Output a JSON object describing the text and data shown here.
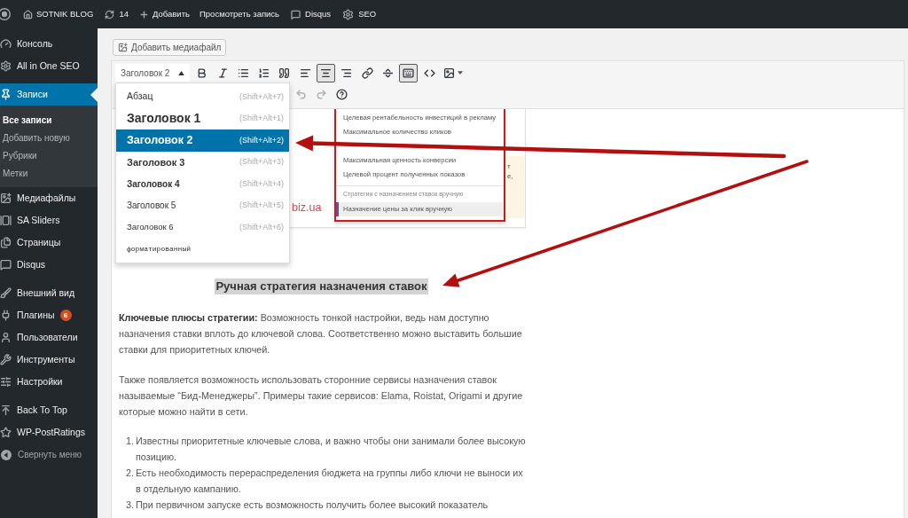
{
  "admin_bar": {
    "site_name": "SOTNIK BLOG",
    "updates_count": "14",
    "add_new": "Добавить",
    "view_post": "Просмотреть запись",
    "disqus": "Disqus",
    "seo": "SEO"
  },
  "sidebar": {
    "sections": [
      {
        "items": [
          {
            "kind": "dashboard",
            "label": "Консоль",
            "selected": false
          },
          {
            "kind": "gear",
            "label": "All in One SEO",
            "selected": false
          }
        ]
      },
      {
        "items": [
          {
            "kind": "pin",
            "label": "Записи",
            "selected": true,
            "children": [
              {
                "label": "Все записи",
                "selected": true
              },
              {
                "label": "Добавить новую",
                "selected": false
              },
              {
                "label": "Рубрики",
                "selected": false
              },
              {
                "label": "Метки",
                "selected": false
              }
            ]
          },
          {
            "kind": "media",
            "label": "Медиафайлы",
            "selected": false
          },
          {
            "kind": "slides",
            "label": "SA Sliders",
            "selected": false
          },
          {
            "kind": "pages",
            "label": "Страницы",
            "selected": false
          },
          {
            "kind": "comment",
            "label": "Disqus",
            "selected": false
          }
        ]
      },
      {
        "items": [
          {
            "kind": "brush",
            "label": "Внешний вид",
            "selected": false
          },
          {
            "kind": "plug",
            "label": "Плагины",
            "badge": "6",
            "selected": false
          },
          {
            "kind": "user",
            "label": "Пользователи",
            "selected": false
          },
          {
            "kind": "wrench",
            "label": "Инструменты",
            "selected": false
          },
          {
            "kind": "settings",
            "label": "Настройки",
            "selected": false
          }
        ]
      },
      {
        "items": [
          {
            "kind": "upload",
            "label": "Back To Top",
            "selected": false
          },
          {
            "kind": "star",
            "label": "WP-PostRatings",
            "selected": false
          }
        ]
      }
    ],
    "collapse": "Свернуть меню"
  },
  "editor": {
    "media_button": "Добавить медиафайл",
    "format_select": {
      "value": "Заголовок 2",
      "expanded": true,
      "options": [
        {
          "kind": "paragraph",
          "label": "Абзац",
          "shortcut": "(Shift+Alt+7)",
          "selected": false
        },
        {
          "kind": "h1",
          "label": "Заголовок 1",
          "shortcut": "(Shift+Alt+1)",
          "selected": false
        },
        {
          "kind": "h2",
          "label": "Заголовок 2",
          "shortcut": "(Shift+Alt+2)",
          "selected": true
        },
        {
          "kind": "h3",
          "label": "Заголовок 3",
          "shortcut": "(Shift+Alt+3)",
          "selected": false
        },
        {
          "kind": "h4",
          "label": "Заголовок 4",
          "shortcut": "(Shift+Alt+4)",
          "selected": false
        },
        {
          "kind": "h5",
          "label": "Заголовок 5",
          "shortcut": "(Shift+Alt+5)",
          "selected": false
        },
        {
          "kind": "h6",
          "label": "Заголовок 6",
          "shortcut": "(Shift+Alt+6)",
          "selected": false
        },
        {
          "kind": "pre",
          "label": "форматированный",
          "selected": false
        }
      ]
    },
    "toolbar_row_1": [
      {
        "kind": "bold",
        "pressed": false
      },
      {
        "kind": "italic",
        "pressed": false
      },
      {
        "kind": "bullet_list",
        "pressed": false
      },
      {
        "kind": "numbered_list",
        "pressed": false
      },
      {
        "kind": "blockquote",
        "pressed": false
      },
      {
        "kind": "align_left",
        "pressed": false
      },
      {
        "kind": "align_center",
        "pressed": true
      },
      {
        "kind": "align_right",
        "pressed": false
      },
      {
        "kind": "link",
        "pressed": false
      },
      {
        "kind": "read_more",
        "pressed": false
      },
      {
        "kind": "toolbar_toggle",
        "pressed": true
      },
      {
        "kind": "code",
        "pressed": false
      },
      {
        "kind": "add_image",
        "pressed": false
      }
    ],
    "toolbar_row_2": [
      {
        "kind": "undo",
        "disabled": true
      },
      {
        "kind": "redo",
        "disabled": true
      },
      {
        "kind": "help",
        "disabled": false
      }
    ],
    "content": {
      "post_image": {
        "site_fragment": "biz.ua",
        "strategy_menu": {
          "groups": [
            {
              "items": [
                {
                  "label": "Целевая рентабельность инвестиций в рекламу",
                  "selected": false
                },
                {
                  "label": "Максимальное количество кликов",
                  "selected": false
                }
              ]
            },
            {
              "items": [
                {
                  "label": "Максимальная ценность конверсии",
                  "selected": false
                },
                {
                  "label": "Целевой процент полученных показов",
                  "selected": false
                }
              ]
            },
            {
              "label": "Стратегии с назначением ставок вручную",
              "items": [
                {
                  "label": "Назначение цены за клик вручную",
                  "selected": true
                }
              ]
            }
          ]
        },
        "note_fragments": [
          "т",
          "е,"
        ]
      },
      "heading": {
        "text": "Ручная стратегия назначения ставок",
        "selected": true
      },
      "paragraphs": [
        "**Ключевые плюсы стратегии:** Возможность тонкой настройки, ведь нам доступно назначения ставки вплоть до ключевой слова. Соответственно можно выставить большие ставки для приоритетных ключей.",
        "Также появляется возможность использовать сторонние сервисы назначения ставок называемые “Бид-Менеджеры”. Примеры такие сервисов: Elama, Roistat, Origami и другие которые можно найти в сети."
      ],
      "list": [
        {
          "number": "1.",
          "text": "Известны приоритетные ключевые слова, и важно чтобы они занимали более высокую позицию."
        },
        {
          "number": "2.",
          "text": "Есть необходимость перераспределения бюджета на группы либо ключи не выноси их в отдельную кампанию."
        },
        {
          "number": "3.",
          "text": "При первичном запуске есть возможность получить более высокий показатель"
        }
      ]
    }
  }
}
